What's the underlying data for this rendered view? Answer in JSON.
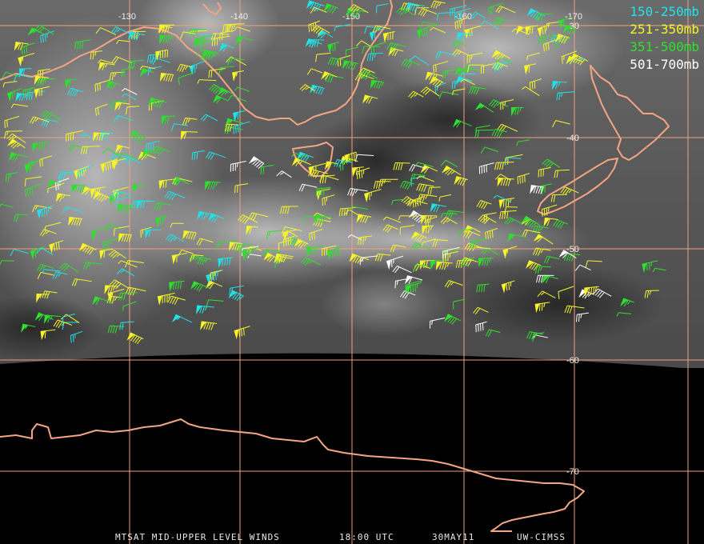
{
  "map": {
    "longitude_labels": [
      "-130",
      "-140",
      "-150",
      "-160",
      "-170"
    ],
    "latitude_labels": [
      "-30",
      "-40",
      "-50",
      "-60",
      "-70"
    ]
  },
  "legend": [
    {
      "label": "150-250mb",
      "color": "#21e3e8"
    },
    {
      "label": "251-350mb",
      "color": "#f5f52a"
    },
    {
      "label": "351-500mb",
      "color": "#2fe02f"
    },
    {
      "label": "501-700mb",
      "color": "#ffffff"
    }
  ],
  "footer": {
    "product": "MTSAT MID-UPPER LEVEL WINDS",
    "time": "18:00 UTC",
    "date": "30MAY11",
    "source": "UW-CIMSS"
  },
  "colors": {
    "grid": "#f0a080",
    "coast": "#f4a583",
    "background": "#000000"
  }
}
